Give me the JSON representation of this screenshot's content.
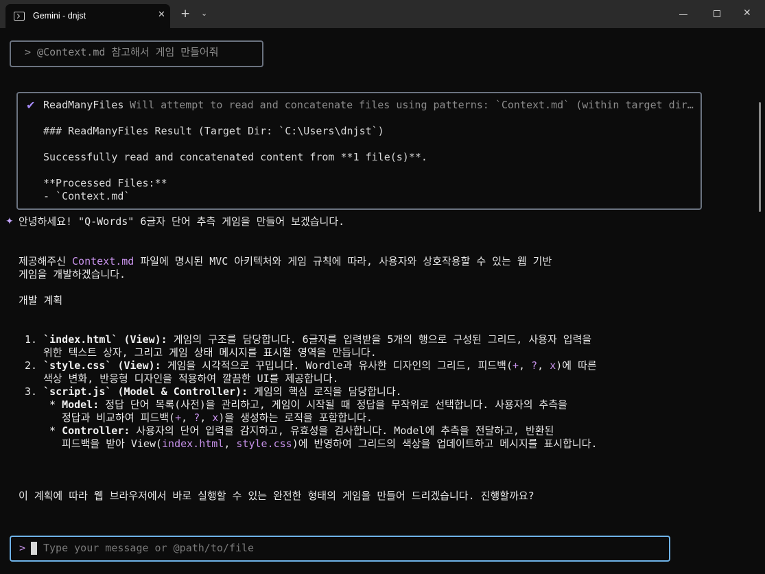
{
  "window": {
    "tab_title": "Gemini - dnjst",
    "new_tab": "+",
    "dropdown": "⌄",
    "close_tab": "✕",
    "close_window": "✕"
  },
  "prompt": {
    "text": "> @Context.md 참고해서 게임 만들어줘"
  },
  "tool_call": {
    "icon": "check-icon",
    "check": "✔",
    "name": "ReadManyFiles",
    "description": "Will attempt to read and concatenate files using patterns: `Context.md` (within target directory",
    "result_heading": "### ReadManyFiles Result (Target Dir: `C:\\Users\\dnjst`)",
    "success_line": "Successfully read and concatenated content from **1 file(s)**.",
    "processed_heading": "**Processed Files:**",
    "processed_item": "- `Context.md`"
  },
  "response": {
    "spark": "✦",
    "greeting": "안녕하세요! \"Q-Words\" 6글자 단어 추측 게임을 만들어 보겠습니다.",
    "intro_1_pre": "제공해주신 ",
    "intro_1_file": "Context.md",
    "intro_1_post": " 파일에 명시된 MVC 아키텍처와 게임 규칙에 따라, 사용자와 상호작용할 수 있는 웹 기반",
    "intro_2": "게임을 개발하겠습니다.",
    "plan_heading": "개발 계획",
    "item1_num": "1. ",
    "item1_bold": "`index.html` (View):",
    "item1_text": " 게임의 구조를 담당합니다. 6글자를 입력받을 5개의 행으로 구성된 그리드, 사용자 입력을",
    "item1_cont": "위한 텍스트 상자, 그리고 게임 상태 메시지를 표시할 영역을 만듭니다.",
    "item2_num": "2. ",
    "item2_bold": "`style.css` (View):",
    "item2_text_a": " 게임을 시각적으로 꾸밉니다. Wordle과 유사한 디자인의 그리드, 피드백(",
    "fb_plus": "+",
    "fb_q": "?",
    "fb_x": "x",
    "sep": ", ",
    "item2_text_b": ")에 따른",
    "item2_cont": "색상 변화, 반응형 디자인을 적용하여 깔끔한 UI를 제공합니다.",
    "item3_num": "3. ",
    "item3_bold": "`script.js` (Model & Controller):",
    "item3_text": " 게임의 핵심 로직을 담당합니다.",
    "sub1_bullet": "* ",
    "sub1_bold": "Model:",
    "sub1_text": " 정답 단어 목록(사전)을 관리하고, 게임이 시작될 때 정답을 무작위로 선택합니다. 사용자의 추측을",
    "sub1_cont_a": "정답과 비교하여 피드백(",
    "sub1_cont_b": ")을 생성하는 로직을 포함합니다.",
    "sub2_bullet": "* ",
    "sub2_bold": "Controller:",
    "sub2_text": " 사용자의 단어 입력을 감지하고, 유효성을 검사합니다. Model에 추측을 전달하고, 반환된",
    "sub2_cont_a": "피드백을 받아 View(",
    "sub2_file1": "index.html",
    "sub2_file2": "style.css",
    "sub2_cont_b": ")에 반영하여 그리드의 색상을 업데이트하고 메시지를 표시합니다.",
    "closing": "이 계획에 따라 웹 브라우저에서 바로 실행할 수 있는 완전한 형태의 게임을 만들어 드리겠습니다. 진행할까요?"
  },
  "input": {
    "caret": ">",
    "placeholder": "Type your message or @path/to/file"
  }
}
